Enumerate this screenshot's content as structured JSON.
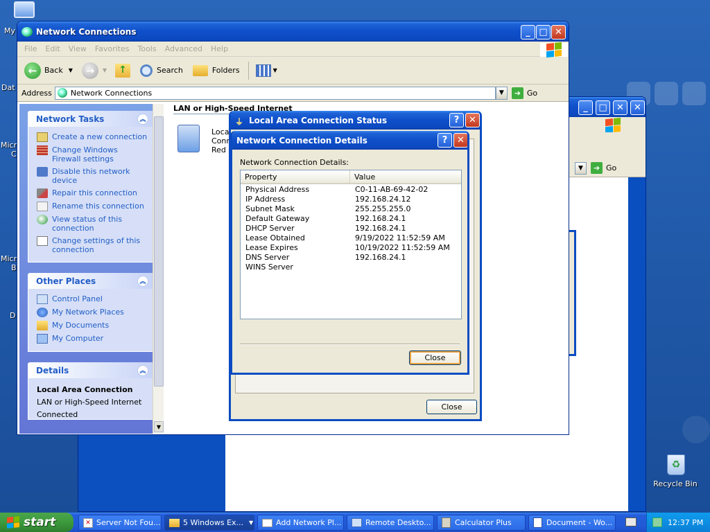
{
  "desktop": {
    "icons": [
      {
        "label": "My"
      },
      {
        "label": "Dat"
      },
      {
        "label": "Micro"
      },
      {
        "label": "C"
      },
      {
        "label": "Micro"
      },
      {
        "label": "B"
      },
      {
        "label": "D"
      }
    ],
    "recycle_bin": "Recycle Bin"
  },
  "main_window": {
    "title": "Network Connections",
    "menu": [
      "File",
      "Edit",
      "View",
      "Favorites",
      "Tools",
      "Advanced",
      "Help"
    ],
    "toolbar": {
      "back": "Back",
      "search": "Search",
      "folders": "Folders"
    },
    "address": {
      "label": "Address",
      "value": "Network Connections",
      "go": "Go"
    },
    "network_tasks": {
      "title": "Network Tasks",
      "items": [
        "Create a new connection",
        "Change Windows Firewall settings",
        "Disable this network device",
        "Repair this connection",
        "Rename this connection",
        "View status of this connection",
        "Change settings of this connection"
      ]
    },
    "other_places": {
      "title": "Other Places",
      "items": [
        "Control Panel",
        "My Network Places",
        "My Documents",
        "My Computer"
      ]
    },
    "details": {
      "title": "Details",
      "name": "Local Area Connection",
      "type": "LAN or High-Speed Internet",
      "status": "Connected"
    },
    "content": {
      "group_header": "LAN or High-Speed Internet",
      "item_lines": [
        "Local",
        "Conn",
        "Red I"
      ]
    }
  },
  "back_window": {
    "go": "Go"
  },
  "status_dialog": {
    "title": "Local Area Connection Status",
    "close": "Close"
  },
  "details_dialog": {
    "title": "Network Connection Details",
    "caption": "Network Connection Details:",
    "columns": [
      "Property",
      "Value"
    ],
    "rows": [
      [
        "Physical Address",
        "C0-11-AB-69-42-02"
      ],
      [
        "IP Address",
        "192.168.24.12"
      ],
      [
        "Subnet Mask",
        "255.255.255.0"
      ],
      [
        "Default Gateway",
        "192.168.24.1"
      ],
      [
        "DHCP Server",
        "192.168.24.1"
      ],
      [
        "Lease Obtained",
        "9/19/2022 11:52:59 AM"
      ],
      [
        "Lease Expires",
        "10/19/2022 11:52:59 AM"
      ],
      [
        "DNS Server",
        "192.168.24.1"
      ],
      [
        "WINS Server",
        ""
      ]
    ],
    "close": "Close"
  },
  "taskbar": {
    "start": "start",
    "items": [
      "Server Not Fou...",
      "5 Windows Ex...",
      "Add Network Pl...",
      "Remote Deskto...",
      "Calculator Plus",
      "Document - Wo..."
    ],
    "clock": "12:37 PM"
  }
}
